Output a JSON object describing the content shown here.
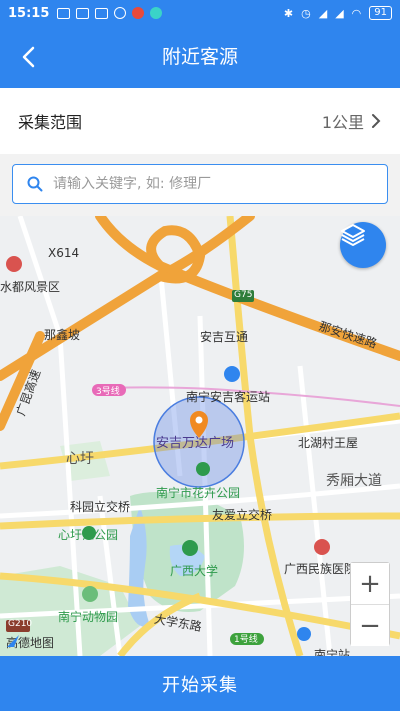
{
  "status_bar": {
    "time": "15:15",
    "battery": "91"
  },
  "header": {
    "title": "附近客源"
  },
  "range": {
    "label": "采集范围",
    "value": "1公里"
  },
  "search": {
    "placeholder": "请输入关键字, 如: 修理厂"
  },
  "map": {
    "labels": {
      "x614": "X614",
      "scenic": "水都风景区",
      "napo": "那鑫坡",
      "anji_interchange": "安吉互通",
      "g75": "G75",
      "naan_expressway": "那安快速路",
      "line3": "3号线",
      "bus_station": "南宁安吉客运站",
      "wanda": "安吉万达广场",
      "beihu": "北湖村王屋",
      "xinxu": "心圩",
      "xiuxiang": "秀厢大道",
      "keyuan": "科园立交桥",
      "flower_park": "南宁市花卉公园",
      "youai": "友爱立交桥",
      "xinxu_park": "心圩江公园",
      "gxu": "广西大学",
      "gx_hospital": "广西民族医院",
      "zoo": "南宁动物园",
      "daxue_road": "大学东路",
      "line1": "1号线",
      "g210": "G210",
      "nanning_station": "南宁站",
      "kunlun_expressway": "广昆高速"
    },
    "logo": "高德地图",
    "accent": "#2f85ee"
  },
  "actions": {
    "start": "开始采集"
  }
}
